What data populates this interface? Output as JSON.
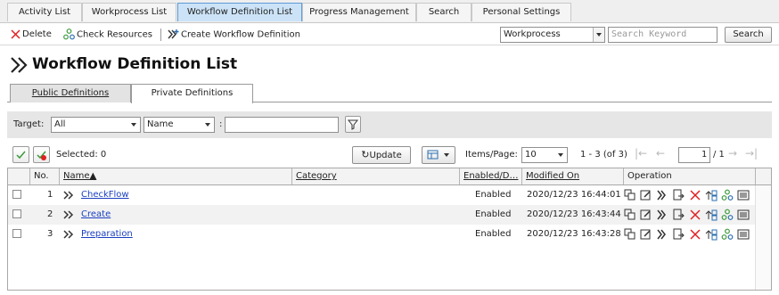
{
  "top_tabs": [
    {
      "label": "Activity List",
      "active": false
    },
    {
      "label": "Workprocess List",
      "active": false
    },
    {
      "label": "Workflow Definition List",
      "active": true
    },
    {
      "label": "Progress Management",
      "active": false
    },
    {
      "label": "Search",
      "active": false
    },
    {
      "label": "Personal Settings",
      "active": false
    }
  ],
  "toolbar": {
    "delete_label": "Delete",
    "check_resources_label": "Check Resources",
    "create_workflow_label": "Create Workflow Definition",
    "search_scope_value": "Workprocess",
    "search_placeholder": "Search Keyword",
    "search_button": "Search"
  },
  "page": {
    "title": "Workflow Definition List"
  },
  "sub_tabs": [
    {
      "label": "Public Definitions",
      "active": false
    },
    {
      "label": "Private Definitions",
      "active": true
    }
  ],
  "filter": {
    "target_label": "Target:",
    "target_value": "All",
    "field_value": "Name",
    "colon": ":",
    "keyword_value": ""
  },
  "list_toolbar": {
    "selected_text": "Selected: 0",
    "update_label": "Update",
    "items_per_page_label": "Items/Page:",
    "items_per_page_value": "10",
    "range_text": "1 - 3 (of 3)",
    "page_value": "1",
    "page_total": "/ 1"
  },
  "table": {
    "columns": {
      "no": "No.",
      "name": "Name▲",
      "category": "Category",
      "enabled": "Enabled/D…",
      "modified": "Modified On",
      "operation": "Operation"
    },
    "rows": [
      {
        "no": "1",
        "name": "CheckFlow",
        "category": "",
        "enabled": "Enabled",
        "modified": "2020/12/23 16:44:01"
      },
      {
        "no": "2",
        "name": "Create",
        "category": "",
        "enabled": "Enabled",
        "modified": "2020/12/23 16:43:44"
      },
      {
        "no": "3",
        "name": "Preparation",
        "category": "",
        "enabled": "Enabled",
        "modified": "2020/12/23 16:43:28"
      }
    ]
  },
  "colors": {
    "active_tab_bg": "#cce3f7",
    "active_tab_border": "#5d9ad6",
    "link": "#1a3fbf",
    "delete_red": "#e02020",
    "icon_green": "#3a9a3a",
    "icon_blue": "#2a6db0"
  }
}
